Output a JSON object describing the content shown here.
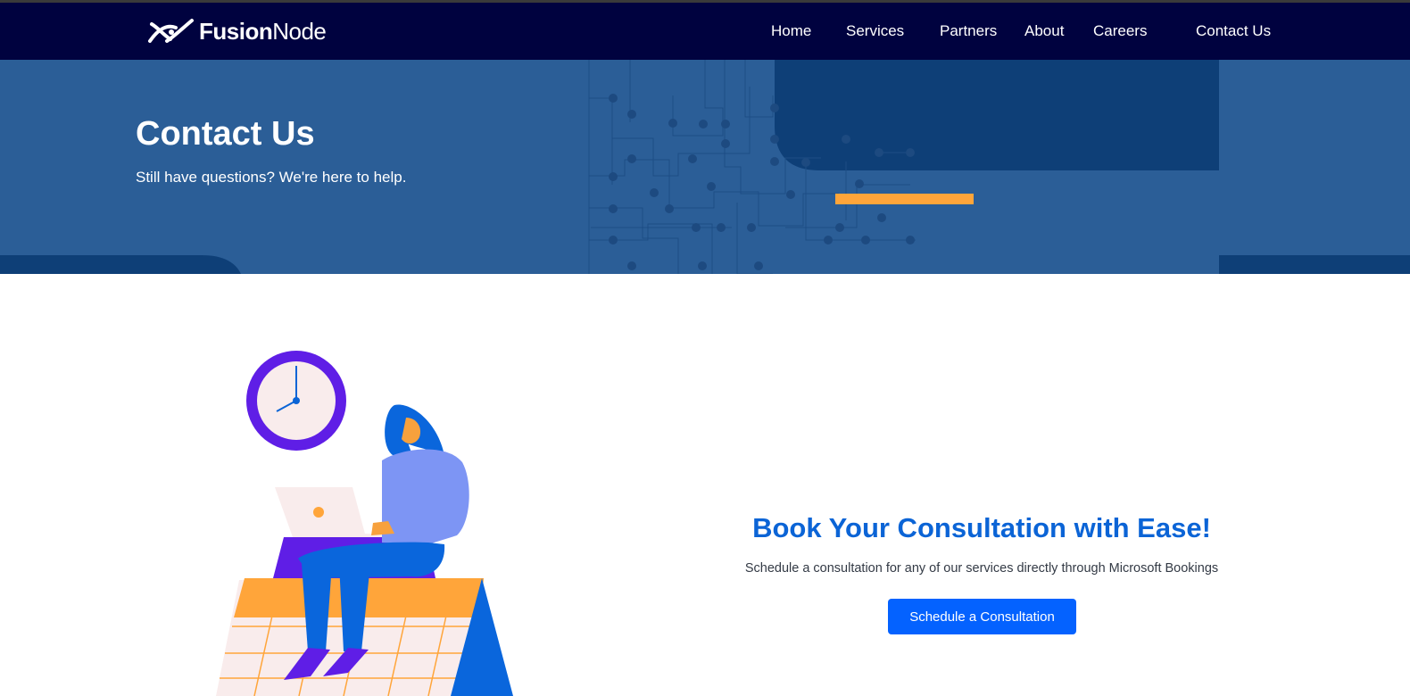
{
  "brand": {
    "name_bold": "Fusion",
    "name_light": "Node",
    "icon": "fusionnode-logo-icon"
  },
  "nav": {
    "items": [
      {
        "label": "Home"
      },
      {
        "label": "Services"
      },
      {
        "label": "Partners"
      },
      {
        "label": "About"
      },
      {
        "label": "Careers"
      },
      {
        "label": "Contact Us"
      }
    ]
  },
  "hero": {
    "title": "Contact Us",
    "subtitle": "Still have questions? We're here to help."
  },
  "booking": {
    "title": "Book Your Consultation with Ease!",
    "description": "Schedule a consultation for any of our services directly through Microsoft Bookings",
    "button_label": "Schedule a Consultation"
  },
  "colors": {
    "navbar": "#00023f",
    "hero": "#2b5e97",
    "accent": "#ffa53a",
    "heading": "#0b64d6",
    "button": "#0462ff"
  }
}
